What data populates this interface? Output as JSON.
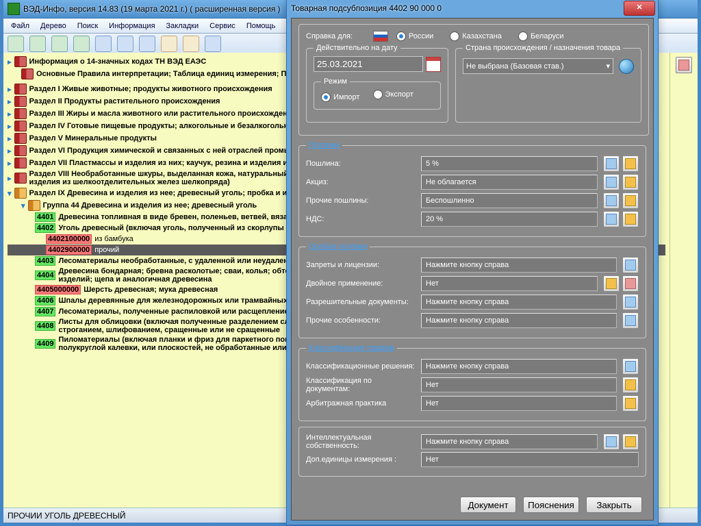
{
  "main": {
    "title": "ВЭД-Инфо, версия 14.83 (19 марта 2021 г.)  ( расширенная версия )",
    "menus": [
      "Файл",
      "Дерево",
      "Поиск",
      "Информация",
      "Закладки",
      "Сервис",
      "Помощь"
    ]
  },
  "status": "ПРОЧИИ УГОЛЬ ДРЕВЕСНЫЙ",
  "tree": {
    "r0": "Информация о 14-значных кодах ТН ВЭД ЕАЭС",
    "r1": "Основные Правила интерпретации; Таблица единиц измерения; Примечания к ЕТН ВЭД ЕАЭС; Предисловие к Пояснениям",
    "r2": "Раздел I Живые животные; продукты животного происхождения",
    "r3": "Раздел II Продукты растительного происхождения",
    "r4": "Раздел III Жиры и масла животного или растительного происхождения и продукты их расщепления; воски животного или растительного происхождения",
    "r5": "Раздел IV Готовые пищевые продукты; алкогольные и безалкогольные напитки и уксус; табак",
    "r6": "Раздел V Минеральные продукты",
    "r7": "Раздел VI Продукция химической и связанных с ней отраслей промышленности",
    "r8": "Раздел VII Пластмассы и изделия из них; каучук, резина и изделия из них",
    "r9": "Раздел VIII Необработанные шкуры, выделанная кожа, натуральный мех и изделия из них; упряжь; дорожные принадлежности, сумки и аналогичные им товары; изделия из шелкоотделительных желез шелкопряда)",
    "r10": "Раздел IX Древесина и изделия из нее; древесный уголь; пробка и изделия из нее; материалов для плетения; корзиночные и другие плетеные изделия",
    "grp": "Группа 44 Древесина и изделия из нее; древесный уголь",
    "c4401": "4401",
    "t4401": "Древесина топливная в виде бревен, поленьев, ветвей, вязанок хвороста или в древесные отходы и скрап, неагломерированные или агломерированные",
    "c4402": "4402",
    "t4402": "Уголь древесный (включая уголь, полученный из скорлупы или орехов)",
    "c44021": "4402100000",
    "t44021": "из бамбука",
    "c44029": "4402900000",
    "t44029": "прочий",
    "c4403": "4403",
    "t4403": "Лесоматериалы необработанные, с удаленной или неудаленной корой",
    "c4404": "4404",
    "t4404": "Древесина бондарная; бревна расколотые; сваи, колья; обтесанные, но не обточенные, не изогнутые или не обработанные; инструментов или аналогичных изделий; щепа и аналогичная древесина",
    "c44050": "4405000000",
    "t44050": "Шерсть древесная; мука древесная",
    "c4406": "4406",
    "t4406": "Шпалы деревянные для железнодорожных или трамвайных путей",
    "c4407": "4407",
    "t4407": "Лесоматериалы, полученные распиловкой или расщеплением вдоль; шлифованием, имеющие или не имеющие торцевые соединения",
    "c4408": "4408",
    "t4408": "Листы для облицовки (включая полученные разделением слоистой древесины); прочие лесоматериалы, полученные распиловкой или расщеплением; строганием, шлифованием, сращенные или не сращенные",
    "c4409": "4409",
    "t4409": "Пиломатериалы (включая планки и фриз для паркетного покрытия пола, несобранные); шпунтованные, со стесанными краями, с соединением в виде полукруглой калевки, или плоскостей, не обработанные или обработанные"
  },
  "dialog": {
    "title": "Товарная подсубпозиция 4402 90 000 0",
    "ref_for": "Справка для:",
    "country1": "России",
    "country2": "Казахстана",
    "country3": "Беларуси",
    "date_lbl": "Действительно на дату",
    "date_val": "25.03.2021",
    "origin_lbl": "Страна происхождения / назначения товара",
    "origin_val": "Не выбрана (Базовая став.)",
    "mode_lbl": "Режим",
    "mode1": "Импорт",
    "mode2": "Экспорт",
    "payments": {
      "legend": "Платежи",
      "duty_l": "Пошлина:",
      "duty_v": "5 %",
      "excise_l": "Акциз:",
      "excise_v": "Не облагается",
      "other_l": "Прочие пошлины:",
      "other_v": "Беспошлинно",
      "vat_l": "НДС:",
      "vat_v": "20 %"
    },
    "special": {
      "legend": "Особые условия",
      "ban_l": "Запреты и лицензии:",
      "ban_v": "Нажмите кнопку справа",
      "dual_l": "Двойное применение:",
      "dual_v": "Нет",
      "perm_l": "Разрешительные документы:",
      "perm_v": "Нажмите кнопку справа",
      "misc_l": "Прочие особенности:",
      "misc_v": "Нажмите кнопку справа"
    },
    "class": {
      "legend": "Классификация товаров",
      "dec_l": "Классификационные решения:",
      "dec_v": "Нажмите кнопку справа",
      "doc_l": "Классификация по документам:",
      "doc_v": "Нет",
      "arb_l": "Арбитражная практика",
      "arb_v": "Нет"
    },
    "ip": {
      "ip_l": "Интеллектуальная собственность:",
      "ip_v": "Нажмите кнопку справа",
      "unit_l": "Доп.единицы измерения :",
      "unit_v": "Нет"
    },
    "btn_doc": "Документ",
    "btn_expl": "Пояснения",
    "btn_close": "Закрыть"
  }
}
